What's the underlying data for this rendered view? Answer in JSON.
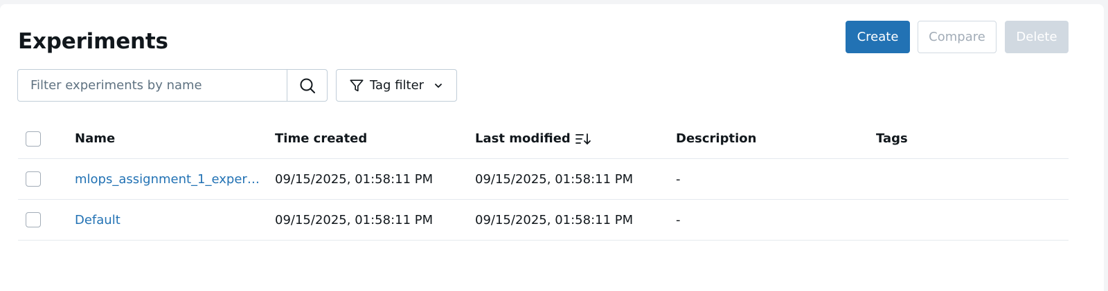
{
  "page": {
    "title": "Experiments"
  },
  "toolbar": {
    "create_label": "Create",
    "compare_label": "Compare",
    "delete_label": "Delete"
  },
  "search": {
    "placeholder": "Filter experiments by name",
    "value": "",
    "icon": "search-icon"
  },
  "tag_filter": {
    "label": "Tag filter",
    "icon": "filter-icon"
  },
  "table": {
    "columns": {
      "name": "Name",
      "time_created": "Time created",
      "last_modified": "Last modified",
      "description": "Description",
      "tags": "Tags"
    },
    "sorted_by": "last_modified",
    "rows": [
      {
        "name": "mlops_assignment_1_experim...",
        "time_created": "09/15/2025, 01:58:11 PM",
        "last_modified": "09/15/2025, 01:58:11 PM",
        "description": "-",
        "tags": ""
      },
      {
        "name": "Default",
        "time_created": "09/15/2025, 01:58:11 PM",
        "last_modified": "09/15/2025, 01:58:11 PM",
        "description": "-",
        "tags": ""
      }
    ]
  },
  "colors": {
    "primary": "#2272b4",
    "link": "#2272b4",
    "disabled_bg": "#d1d9e1",
    "border": "#c0cdd8",
    "text": "#11171c"
  }
}
